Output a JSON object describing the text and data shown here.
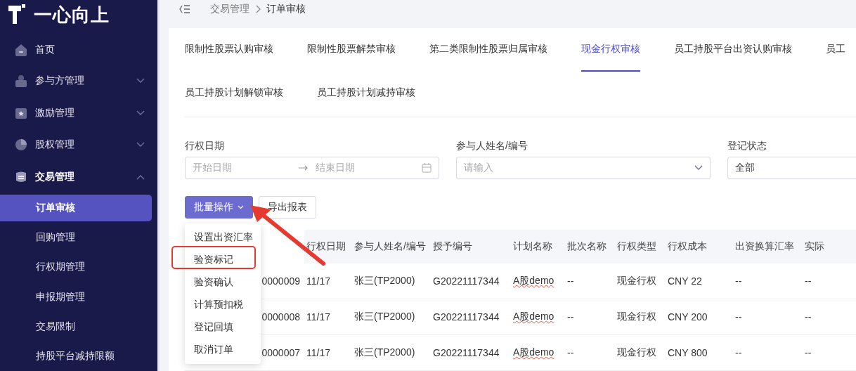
{
  "sidebar": {
    "logo": "一心向上",
    "items": [
      {
        "label": "首页",
        "kind": "link"
      },
      {
        "label": "参与方管理",
        "kind": "group",
        "expanded": false
      },
      {
        "label": "激励管理",
        "kind": "group",
        "expanded": false
      },
      {
        "label": "股权管理",
        "kind": "group",
        "expanded": false
      },
      {
        "label": "交易管理",
        "kind": "group",
        "expanded": true,
        "children": [
          {
            "label": "订单审核",
            "selected": true
          },
          {
            "label": "回购管理",
            "selected": false
          },
          {
            "label": "行权期管理",
            "selected": false
          },
          {
            "label": "申报期管理",
            "selected": false
          },
          {
            "label": "交易限制",
            "selected": false
          },
          {
            "label": "持股平台减持限额",
            "selected": false
          }
        ]
      }
    ]
  },
  "breadcrumb": [
    "交易管理",
    "订单审核"
  ],
  "tabs": [
    [
      {
        "label": "限制性股票认购审核",
        "selected": false
      },
      {
        "label": "限制性股票解禁审核",
        "selected": false
      },
      {
        "label": "第二类限制性股票归属审核",
        "selected": false
      },
      {
        "label": "现金行权审核",
        "selected": true
      },
      {
        "label": "员工持股平台出资认购审核",
        "selected": false
      },
      {
        "label": "员工",
        "selected": false
      }
    ],
    [
      {
        "label": "员工持股计划解锁审核",
        "selected": false
      },
      {
        "label": "员工持股计划减持审核",
        "selected": false
      }
    ]
  ],
  "filters": {
    "date": {
      "label": "行权日期",
      "start_placeholder": "开始日期",
      "end_placeholder": "结束日期"
    },
    "participant": {
      "label": "参与人姓名/编号",
      "placeholder": "请输入"
    },
    "status": {
      "label": "登记状态",
      "value": "全部"
    }
  },
  "actions": {
    "batch": "批量操作",
    "export": "导出报表"
  },
  "batch_menu": [
    {
      "label": "设置出资汇率",
      "highlighted": false
    },
    {
      "label": "验资标记",
      "highlighted": true
    },
    {
      "label": "验资确认",
      "highlighted": false
    },
    {
      "label": "计算预扣税",
      "highlighted": false
    },
    {
      "label": "登记回填",
      "highlighted": false
    },
    {
      "label": "取消订单",
      "highlighted": false
    }
  ],
  "table": {
    "columns": [
      "",
      "行权日期",
      "参与人姓名/编号",
      "授予编号",
      "计划名称",
      "批次名称",
      "行权类型",
      "行权成本",
      "出资换算汇率",
      "实际"
    ],
    "rows": [
      [
        "0000009",
        "11/17",
        "张三(TP2000)",
        "G20221117344",
        "A股demo",
        "--",
        "现金行权",
        "CNY 22",
        "--",
        "--"
      ],
      [
        "0000008",
        "11/17",
        "张三(TP2000)",
        "G20221117344",
        "A股demo",
        "--",
        "现金行权",
        "CNY 200",
        "--",
        "--"
      ],
      [
        "0000007",
        "11/17",
        "张三(TP2000)",
        "G20221117344",
        "A股demo",
        "--",
        "现金行权",
        "CNY 800",
        "--",
        "--"
      ]
    ]
  }
}
